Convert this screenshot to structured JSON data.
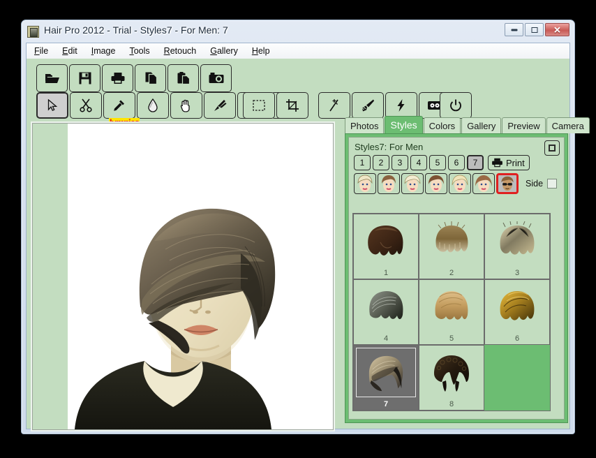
{
  "window": {
    "title": "Hair Pro 2012 - Trial - Styles7 - For Men: 7",
    "icon": "app-icon",
    "controls": {
      "minimize": "—",
      "maximize": "□",
      "close": "✕"
    }
  },
  "menu": [
    {
      "label": "File",
      "accel": "F"
    },
    {
      "label": "Edit",
      "accel": "E"
    },
    {
      "label": "Image",
      "accel": "I"
    },
    {
      "label": "Tools",
      "accel": "T"
    },
    {
      "label": "Retouch",
      "accel": "R"
    },
    {
      "label": "Gallery",
      "accel": "G"
    },
    {
      "label": "Help",
      "accel": "H"
    }
  ],
  "toolbar_file": [
    {
      "icon": "open-folder-icon",
      "name": "open-button"
    },
    {
      "icon": "save-floppy-icon",
      "name": "save-button"
    },
    {
      "icon": "printer-icon",
      "name": "print-button"
    },
    {
      "icon": "copy-icon",
      "name": "copy-button"
    },
    {
      "icon": "paste-icon",
      "name": "paste-button"
    },
    {
      "icon": "camera-icon",
      "name": "camera-button"
    }
  ],
  "toolbar_tools": [
    {
      "icon": "cursor-arrow-icon",
      "name": "select-tool",
      "selected": true
    },
    {
      "icon": "scissors-icon",
      "name": "cut-tool",
      "selected": false
    },
    {
      "icon": "eyedropper-icon",
      "name": "color-picker-tool",
      "selected": false
    },
    {
      "icon": "water-drop-icon",
      "name": "blur-tool",
      "selected": false
    },
    {
      "icon": "hand-icon",
      "name": "hand-tool",
      "selected": false
    },
    {
      "icon": "brushes-icon",
      "name": "brushes-tool",
      "selected": false
    },
    {
      "icon": "spray-icon",
      "name": "spray-tool",
      "selected": false
    },
    {
      "icon": "lasso-icon",
      "name": "lasso-tool",
      "selected": false
    }
  ],
  "toolbar_tools2": [
    {
      "icon": "marquee-select-icon",
      "name": "rectangle-select-tool",
      "selected": false
    },
    {
      "icon": "crop-icon",
      "name": "crop-tool",
      "selected": false
    }
  ],
  "toolbar_tools3": [
    {
      "icon": "magic-wand-icon",
      "name": "magic-wand-tool",
      "selected": false
    },
    {
      "icon": "paintbrush-icon",
      "name": "paint-tool",
      "selected": false
    },
    {
      "icon": "lightning-icon",
      "name": "effects-tool",
      "selected": false
    },
    {
      "icon": "cassette-icon",
      "name": "record-tool",
      "selected": false
    }
  ],
  "toolbar_power": [
    {
      "icon": "power-icon",
      "name": "power-button"
    }
  ],
  "watermark": {
    "text": "lumpics"
  },
  "canvas": {
    "name": "photo-canvas",
    "subject": "woman-portrait-with-hairstyle"
  },
  "tabs": [
    {
      "label": "Photos",
      "active": false
    },
    {
      "label": "Styles",
      "active": true
    },
    {
      "label": "Colors",
      "active": false
    },
    {
      "label": "Gallery",
      "active": false
    },
    {
      "label": "Preview",
      "active": false
    },
    {
      "label": "Camera",
      "active": false
    }
  ],
  "panel": {
    "title": "Styles7: For Men",
    "expand_icon": "expand-window-icon",
    "page_buttons": [
      {
        "label": "1",
        "selected": false
      },
      {
        "label": "2",
        "selected": false
      },
      {
        "label": "3",
        "selected": false
      },
      {
        "label": "4",
        "selected": false
      },
      {
        "label": "5",
        "selected": false
      },
      {
        "label": "6",
        "selected": false
      },
      {
        "label": "7",
        "selected": true
      }
    ],
    "print_label": "Print",
    "print_icon": "printer-icon",
    "face_buttons": [
      {
        "name": "face-blonde-short",
        "selected": false,
        "hair": "#efe6c7",
        "skin": "#f3d7bc"
      },
      {
        "name": "face-brown-bob",
        "selected": false,
        "hair": "#8a6240",
        "skin": "#f3d7bc"
      },
      {
        "name": "face-platinum-wavy",
        "selected": false,
        "hair": "#f3ecd2",
        "skin": "#f3d7bc"
      },
      {
        "name": "face-brunette-curly",
        "selected": false,
        "hair": "#7d5233",
        "skin": "#f3d7bc"
      },
      {
        "name": "face-blonde-long",
        "selected": false,
        "hair": "#f0e4bb",
        "skin": "#f3d7bc"
      },
      {
        "name": "face-auburn-long",
        "selected": false,
        "hair": "#9a6a45",
        "skin": "#f3d7bc"
      },
      {
        "name": "face-man-sunglasses",
        "selected": true,
        "hair": "#8a6239",
        "skin": "#c79a68"
      }
    ],
    "side_label": "Side",
    "side_checked": false,
    "styles": [
      {
        "num": "1",
        "selected": false,
        "color_a": "#4b3020",
        "color_b": "#2d1c12",
        "shape": "bowl"
      },
      {
        "num": "2",
        "selected": false,
        "color_a": "#b49a6a",
        "color_b": "#7d6238",
        "shape": "spiky"
      },
      {
        "num": "3",
        "selected": false,
        "color_a": "#d8cda4",
        "color_b": "#6e6a55",
        "shape": "messy"
      },
      {
        "num": "4",
        "selected": false,
        "color_a": "#9aa096",
        "color_b": "#33382f",
        "shape": "slick"
      },
      {
        "num": "5",
        "selected": false,
        "color_a": "#d9b377",
        "color_b": "#a07c45",
        "shape": "layered"
      },
      {
        "num": "6",
        "selected": false,
        "color_a": "#d4a53a",
        "color_b": "#6a4e12",
        "shape": "tousled"
      },
      {
        "num": "7",
        "selected": true,
        "color_a": "#cfc0a0",
        "color_b": "#4a4136",
        "shape": "side-swept"
      },
      {
        "num": "8",
        "selected": false,
        "color_a": "#3a2c1c",
        "color_b": "#15100a",
        "shape": "curly-dark"
      }
    ]
  },
  "colors": {
    "workspace_green": "#c3ddc0",
    "panel_green": "#6cbd72",
    "accent_red": "#e02020",
    "selection_gray": "#6e6e6e",
    "window_chrome": "#d6e1ef"
  }
}
